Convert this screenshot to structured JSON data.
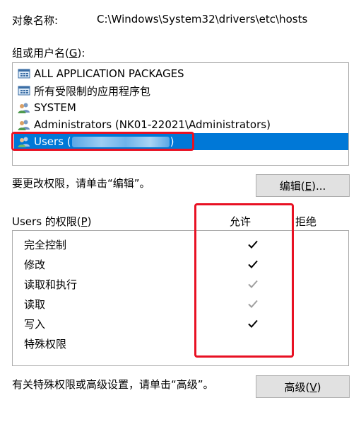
{
  "object": {
    "label": "对象名称:",
    "value": "C:\\Windows\\System32\\drivers\\etc\\hosts"
  },
  "groups": {
    "label": "组或用户名(G):",
    "items": [
      {
        "label": "ALL APPLICATION PACKAGES",
        "icon": "app-packages-icon"
      },
      {
        "label": "所有受限制的应用程序包",
        "icon": "app-packages-icon"
      },
      {
        "label": "SYSTEM",
        "icon": "users-icon"
      },
      {
        "label": "Administrators (NK01-22021\\Administrators)",
        "icon": "users-icon"
      },
      {
        "label_start": "Users (",
        "label_end": ")",
        "icon": "users-icon",
        "selected": true
      }
    ]
  },
  "edit": {
    "hint": "要更改权限，请单击“编辑”。",
    "button": "编辑(E)..."
  },
  "permissions": {
    "title": "Users 的权限(P)",
    "allow_header": "允许",
    "deny_header": "拒绝",
    "rows": [
      {
        "name": "完全控制",
        "allow": "checked"
      },
      {
        "name": "修改",
        "allow": "checked"
      },
      {
        "name": "读取和执行",
        "allow": "checked-disabled"
      },
      {
        "name": "读取",
        "allow": "checked-disabled"
      },
      {
        "name": "写入",
        "allow": "checked"
      },
      {
        "name": "特殊权限",
        "allow": "none"
      }
    ]
  },
  "advanced": {
    "hint": "有关特殊权限或高级设置，请单击“高级”。",
    "button": "高级(V)"
  },
  "colors": {
    "selection": "#0078d7",
    "highlight_box": "#e81123",
    "check_disabled": "#a0a0a0"
  }
}
